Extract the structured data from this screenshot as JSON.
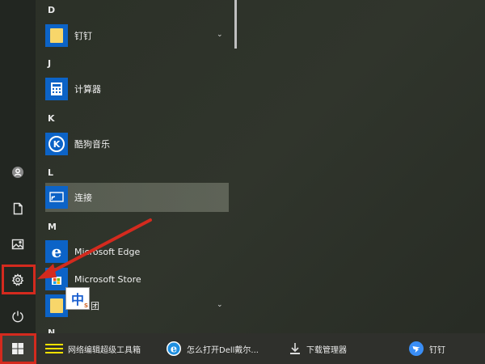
{
  "start_menu": {
    "sections": [
      {
        "letter": "D",
        "apps": [
          {
            "label": "钉钉",
            "icon": "folder-icon",
            "expandable": true
          }
        ]
      },
      {
        "letter": "J",
        "apps": [
          {
            "label": "计算器",
            "icon": "calculator-icon"
          }
        ]
      },
      {
        "letter": "K",
        "apps": [
          {
            "label": "酷狗音乐",
            "icon": "kugou-icon"
          }
        ]
      },
      {
        "letter": "L",
        "apps": [
          {
            "label": "连接",
            "icon": "connect-icon",
            "highlighted": true
          }
        ]
      },
      {
        "letter": "M",
        "apps": [
          {
            "label": "Microsoft Edge",
            "icon": "edge-icon"
          },
          {
            "label": "Microsoft Store",
            "icon": "store-icon"
          },
          {
            "label": "团",
            "icon": "folder-icon",
            "expandable": true
          }
        ]
      },
      {
        "letter": "N",
        "apps": []
      }
    ]
  },
  "sidebar": {
    "buttons": [
      "user-icon",
      "document-icon",
      "pictures-icon",
      "settings-icon",
      "power-icon"
    ]
  },
  "ime": {
    "char": "中",
    "sub": "S"
  },
  "taskbar": {
    "items": [
      {
        "label": "网络编辑超级工具箱",
        "icon": "toolbox-icon"
      },
      {
        "label": "怎么打开Dell戴尔...",
        "icon": "ie-icon"
      },
      {
        "label": "下载管理器",
        "icon": "download-icon"
      },
      {
        "label": "钉钉",
        "icon": "dingtalk-icon"
      }
    ]
  },
  "colors": {
    "annotation_red": "#d42a1e",
    "tile_blue": "#0c63c7",
    "folder_yellow": "#f8d66a"
  }
}
